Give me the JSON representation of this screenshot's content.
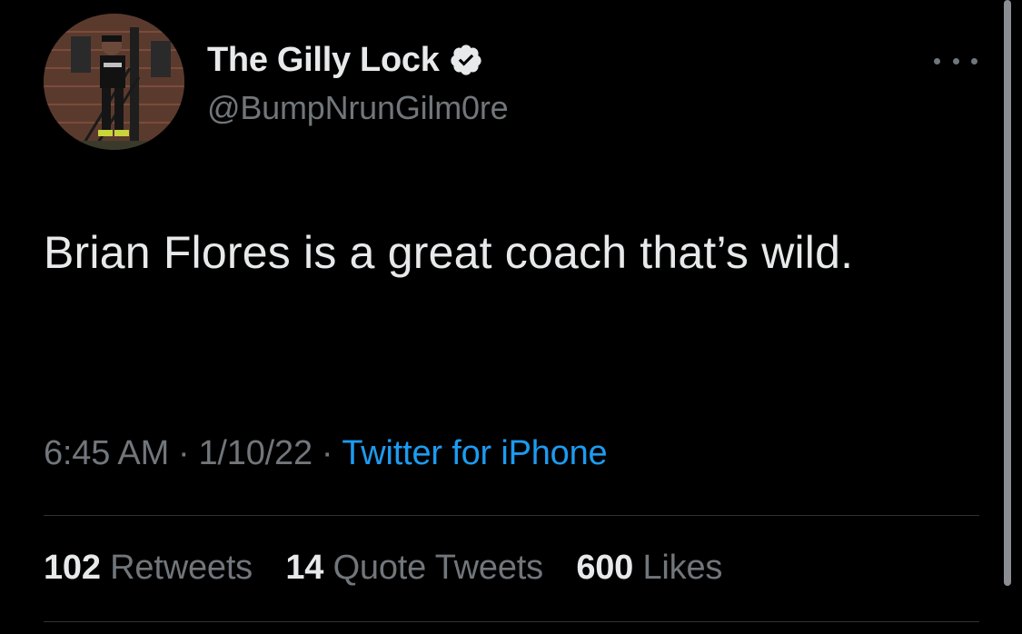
{
  "author": {
    "display_name": "The Gilly Lock",
    "handle": "@BumpNrunGilm0re",
    "verified_icon": "verified-badge-icon",
    "avatar_icon": "avatar"
  },
  "tweet": {
    "text": "Brian Flores is a great coach that’s wild.",
    "time": "6:45 AM",
    "date": "1/10/22",
    "separator": "·",
    "source": "Twitter for iPhone"
  },
  "stats": {
    "retweets_count": "102",
    "retweets_label": "Retweets",
    "quotes_count": "14",
    "quotes_label": "Quote Tweets",
    "likes_count": "600",
    "likes_label": "Likes"
  },
  "colors": {
    "background": "#000000",
    "text": "#e7e9ea",
    "secondary": "#71767b",
    "link": "#1d9bf0",
    "divider": "#2f3336"
  }
}
